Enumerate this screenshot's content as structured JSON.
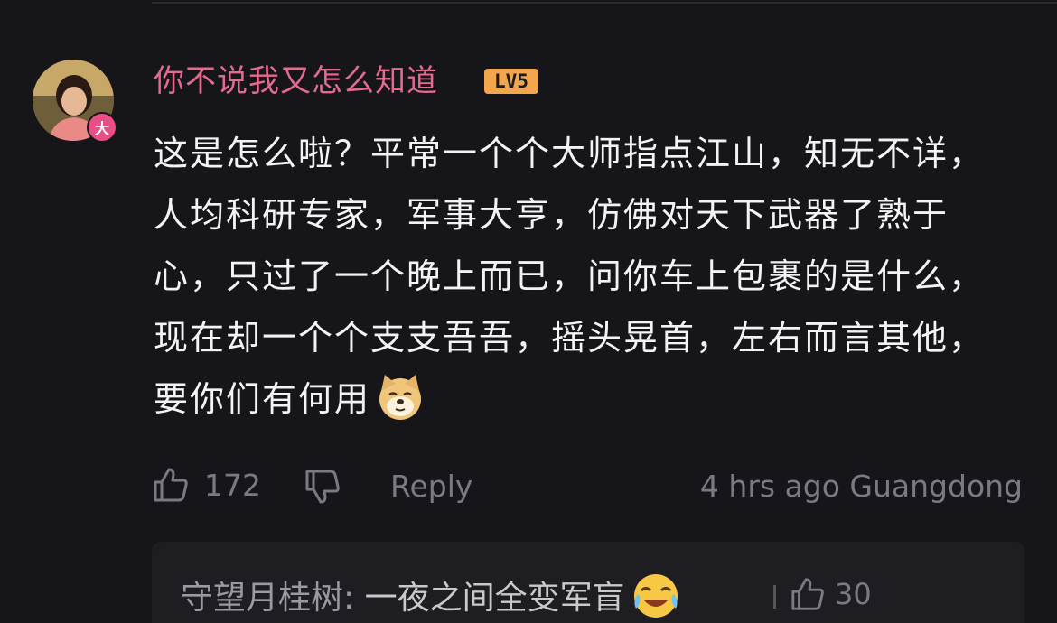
{
  "comment": {
    "username": "你不说我又怎么知道",
    "level": "LV5",
    "avatar_badge": "大",
    "text": "这是怎么啦？平常一个个大师指点江山，知无不详，人均科研专家，军事大亨，仿佛对天下武器了熟于心，只过了一个晚上而已，问你车上包裹的是什么，现在却一个个支支吾吾，摇头晃首，左右而言其他，要你们有何用",
    "emoji": "doge-emoji",
    "likes": "172",
    "reply_label": "Reply",
    "time_location": "4 hrs ago Guangdong"
  },
  "sub_reply": {
    "user": "守望月桂树",
    "separator": ": ",
    "text": "一夜之间全变军盲",
    "emoji": "crying-laughing-emoji",
    "likes": "30"
  },
  "colors": {
    "background": "#16161a",
    "username": "#e46a8f",
    "level_badge": "#f2a64d",
    "text": "#f3f3f3",
    "muted": "#7a7a80"
  }
}
